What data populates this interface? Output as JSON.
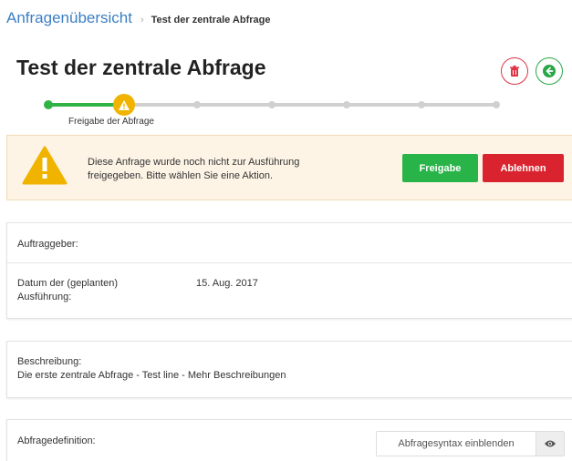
{
  "breadcrumb": {
    "parent": "Anfragenübersicht",
    "separator": "›",
    "current": "Test der zentrale Abfrage"
  },
  "title": "Test der zentrale Abfrage",
  "header_buttons": {
    "delete_icon": "trash-icon",
    "back_icon": "arrow-left-icon"
  },
  "stepper": {
    "active_label": "Freigabe der Abfrage",
    "active_step_index": 1,
    "total_steps": 7
  },
  "alert": {
    "message_line1": "Diese Anfrage wurde noch nicht zur Ausführung",
    "message_line2": "freigegeben. Bitte wählen Sie eine Aktion.",
    "approve_label": "Freigabe",
    "reject_label": "Ablehnen",
    "icon": "warning-triangle-icon"
  },
  "details": {
    "client_label": "Auftraggeber:",
    "client_value": "",
    "date_label_line1": "Datum der (geplanten)",
    "date_label_line2": "Ausführung:",
    "date_value": "15. Aug. 2017"
  },
  "description": {
    "label": "Beschreibung:",
    "value": "Die erste zentrale Abfrage - Test line - Mehr Beschreibungen"
  },
  "definition": {
    "label": "Abfragedefinition:",
    "syntax_button": "Abfragesyntax einblenden",
    "eye_icon": "eye-icon"
  },
  "colors": {
    "link": "#3b7fc4",
    "success": "#28b448",
    "danger": "#d9242f",
    "warning": "#f0b400",
    "alert_bg": "#fdf4e6"
  }
}
